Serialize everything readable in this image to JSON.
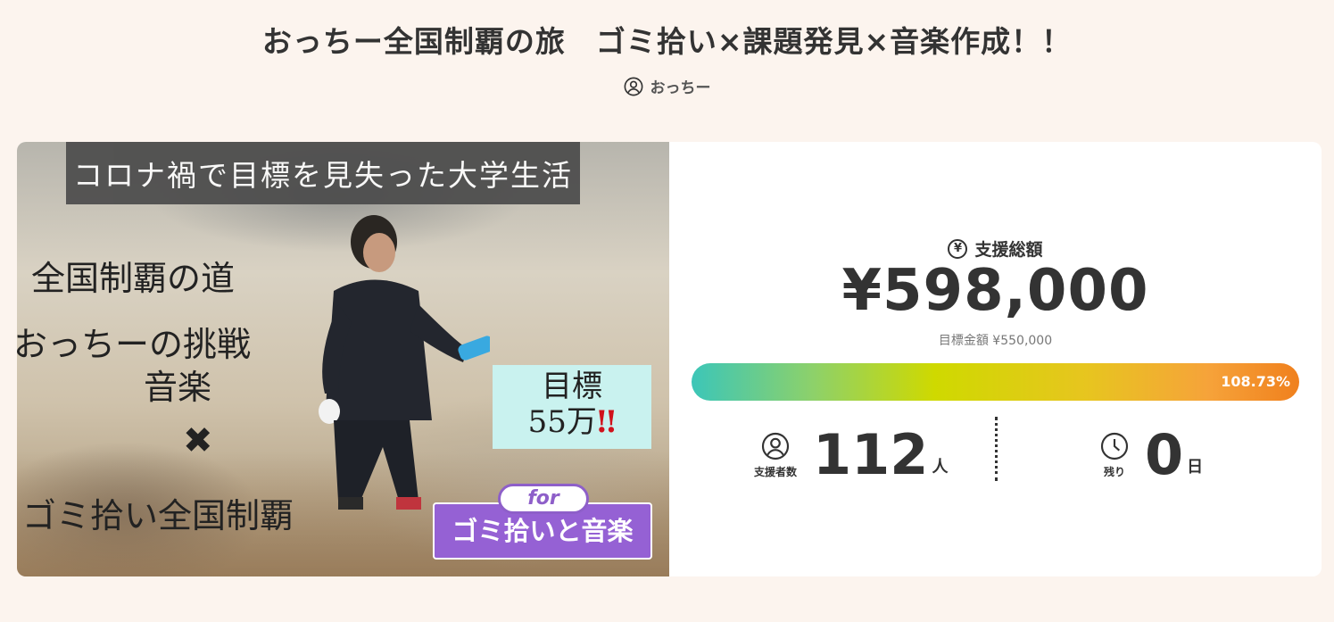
{
  "project": {
    "title": "おっちー全国制覇の旅　ゴミ拾い×課題発見×音楽作成！！",
    "owner": "おっちー"
  },
  "hero": {
    "banner": "コロナ禍で目標を見失った大学生活",
    "line1": "全国制覇の道",
    "line2": "おっちーの挑戦",
    "line3": "音楽",
    "cross": "✖",
    "line4": "ゴミ拾い全国制覇",
    "goal_label": "目標",
    "goal_amount": "55万",
    "goal_bang": "‼",
    "for_label": "for",
    "for_text": "ゴミ拾いと音楽"
  },
  "stats": {
    "total_label": "支援総額",
    "yen_symbol": "¥",
    "total_amount": "¥598,000",
    "goal_text": "目標金額 ¥550,000",
    "progress_fraction": 1.0873,
    "progress_text": "108.73%",
    "supporters_label": "支援者数",
    "supporters_count": "112",
    "supporters_unit": "人",
    "remaining_label": "残り",
    "remaining_count": "0",
    "remaining_unit": "日"
  },
  "colors": {
    "background": "#fcf4ee",
    "accent_purple": "#9561d4",
    "progress_start": "#3cc6b8",
    "progress_end": "#f0801d"
  }
}
